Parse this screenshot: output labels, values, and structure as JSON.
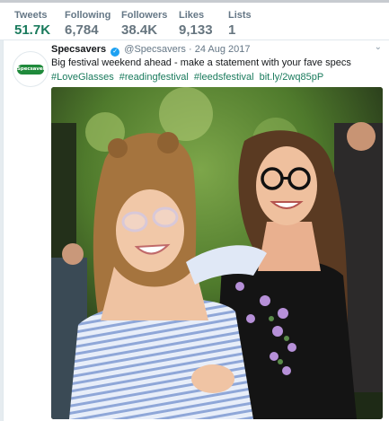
{
  "stats": [
    {
      "label": "Tweets",
      "value": "51.7K"
    },
    {
      "label": "Following",
      "value": "6,784"
    },
    {
      "label": "Followers",
      "value": "38.4K"
    },
    {
      "label": "Likes",
      "value": "9,133"
    },
    {
      "label": "Lists",
      "value": "1"
    }
  ],
  "tweet": {
    "avatar_text": "Specsavers",
    "name": "Specsavers",
    "handle": "@Specsavers",
    "separator": "·",
    "date": "24 Aug 2017",
    "caret": "⌄",
    "text_line": "Big festival weekend ahead - make a statement with your fave specs",
    "tags": [
      "#LoveGlasses",
      "#readingfestival",
      "#leedsfestival",
      "bit.ly/2wq85pP"
    ]
  },
  "colors": {
    "accent": "#197a5c",
    "verified": "#1da1f2",
    "muted": "#657786"
  },
  "icons": {
    "verified": "verified-badge-icon",
    "caret": "chevron-down-icon"
  }
}
